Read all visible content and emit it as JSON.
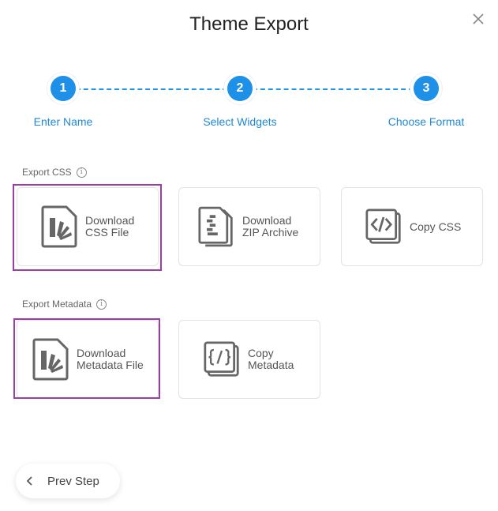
{
  "dialog": {
    "title": "Theme Export"
  },
  "steps": [
    {
      "number": "1",
      "label": "Enter Name"
    },
    {
      "number": "2",
      "label": "Select Widgets"
    },
    {
      "number": "3",
      "label": "Choose Format"
    }
  ],
  "sections": {
    "css": {
      "label": "Export CSS",
      "cards": [
        {
          "label_line1": "Download",
          "label_line2": "CSS File",
          "icon": "file-palette-icon"
        },
        {
          "label_line1": "Download",
          "label_line2": "ZIP Archive",
          "icon": "zip-file-icon"
        },
        {
          "label_line1": "Copy CSS",
          "label_line2": "",
          "icon": "code-icon"
        }
      ]
    },
    "metadata": {
      "label": "Export Metadata",
      "cards": [
        {
          "label_line1": "Download",
          "label_line2": "Metadata File",
          "icon": "file-palette-icon"
        },
        {
          "label_line1": "Copy",
          "label_line2": "Metadata",
          "icon": "braces-code-icon"
        }
      ]
    }
  },
  "footer": {
    "prev_label": "Prev Step"
  },
  "colors": {
    "accent": "#1e90e8",
    "highlight": "#9b3ea8"
  }
}
